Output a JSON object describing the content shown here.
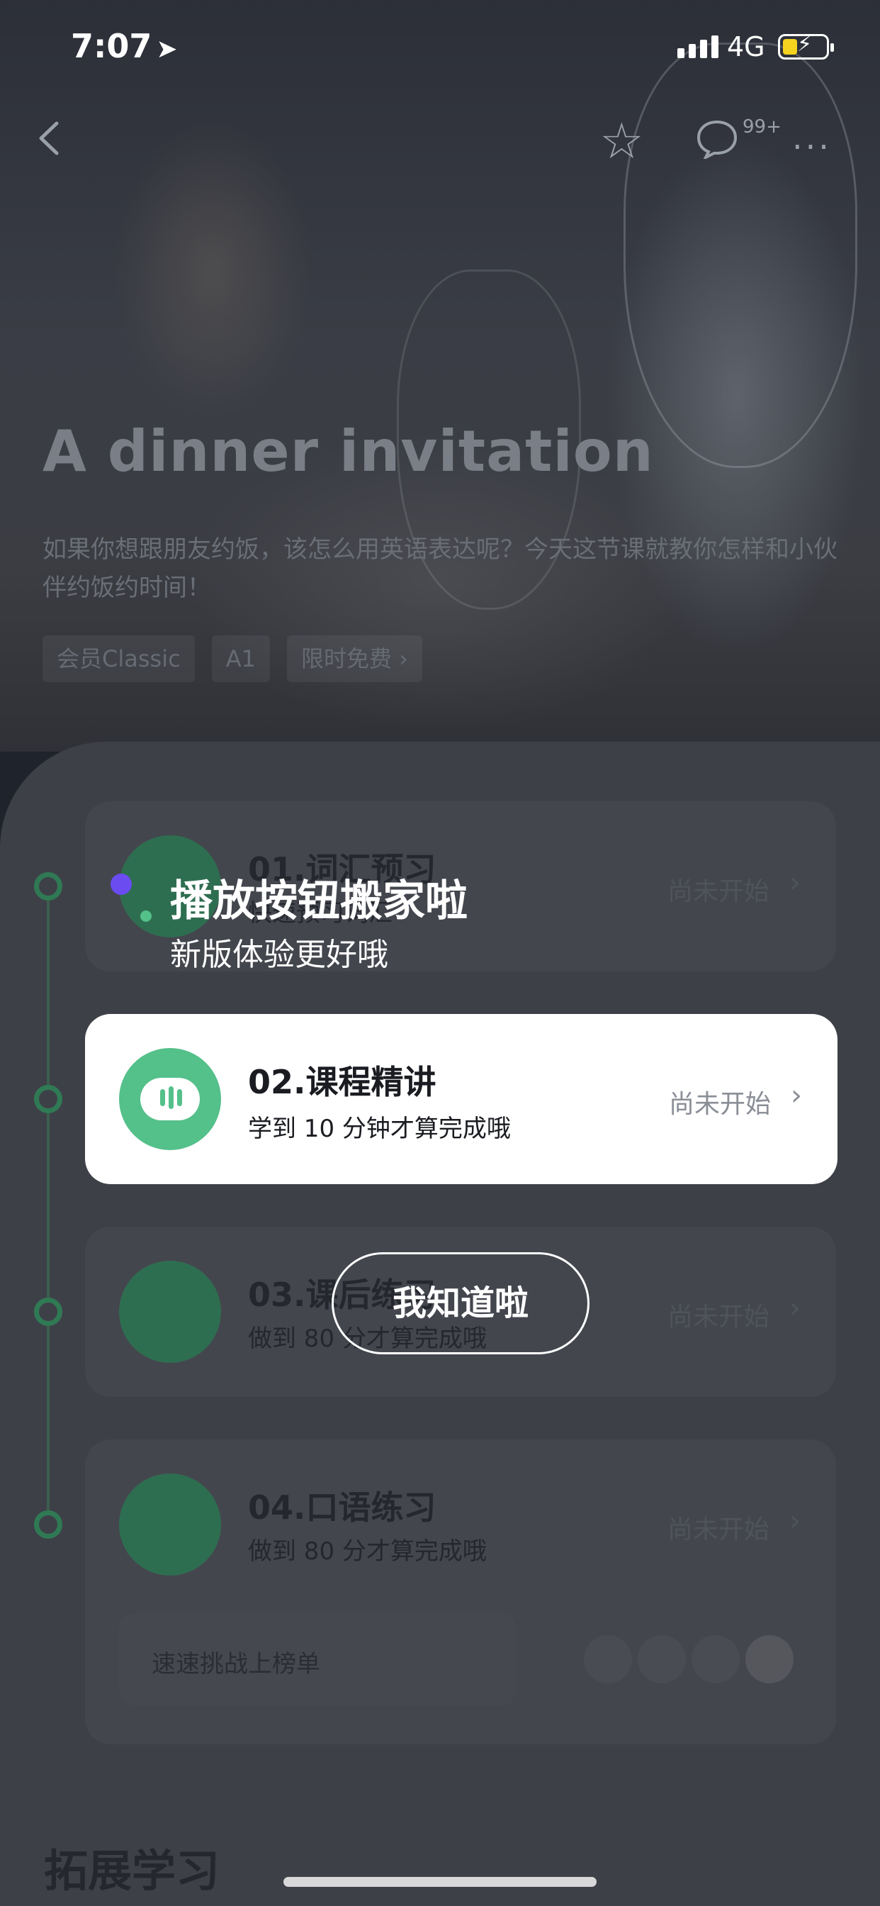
{
  "status_bar": {
    "time": "7:07",
    "network": "4G"
  },
  "nav": {
    "comments_badge": "99+"
  },
  "hero": {
    "title": "A dinner invitation",
    "description": "如果你想跟朋友约饭，该怎么用英语表达呢？今天这节课就教你怎样和小伙伴约饭约时间！",
    "tags": [
      "会员Classic",
      "A1",
      "限时免费 ›"
    ]
  },
  "lessons": [
    {
      "title": "01.词汇预习",
      "subtitle": "快速预习词汇",
      "status": "尚未开始"
    },
    {
      "title": "02.课程精讲",
      "subtitle": "学到 10 分钟才算完成哦",
      "status": "尚未开始"
    },
    {
      "title": "03.课后练习",
      "subtitle": "做到 80 分才算完成哦",
      "status": "尚未开始"
    },
    {
      "title": "04.口语练习",
      "subtitle": "做到 80 分才算完成哦",
      "status": "尚未开始"
    }
  ],
  "ranking": {
    "label": "速速挑战上榜单"
  },
  "section": {
    "extend_title": "拓展学习"
  },
  "tooltip": {
    "title": "播放按钮搬家啦",
    "subtitle": "新版体验更好哦",
    "button": "我知道啦"
  },
  "colors": {
    "accent_green": "#54c08a",
    "tip_dot": "#6a4cf0"
  }
}
